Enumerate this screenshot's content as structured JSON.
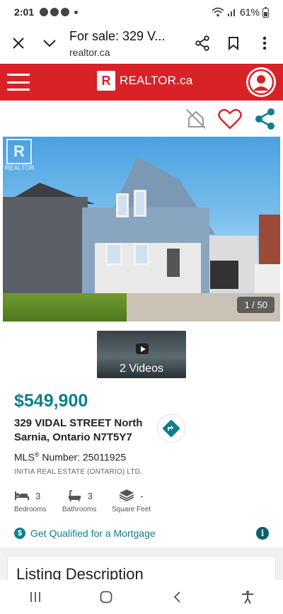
{
  "status_bar": {
    "time": "2:01",
    "battery": "61%"
  },
  "browser": {
    "title": "For sale: 329 V...",
    "domain": "realtor.ca"
  },
  "header": {
    "logo_letter": "R",
    "logo_text": "REALTOR.ca"
  },
  "gallery": {
    "counter": "1 / 50",
    "watermark": "REALTOR"
  },
  "videos": {
    "label": "2 Videos"
  },
  "listing": {
    "price": "$549,900",
    "address_line1": "329 VIDAL STREET North",
    "address_line2": "Sarnia, Ontario N7T5Y7",
    "mls_prefix": "MLS",
    "mls_reg": "®",
    "mls_rest": " Number: 25011925",
    "brokerage": "INITIA REAL ESTATE (ONTARIO) LTD."
  },
  "features": [
    {
      "icon": "bed-icon",
      "value": "3",
      "label": "Bedrooms"
    },
    {
      "icon": "bathtub-icon",
      "value": "3",
      "label": "Bathrooms"
    },
    {
      "icon": "cube-icon",
      "value": "-",
      "label": "Square Feet"
    }
  ],
  "mortgage": {
    "icon_glyph": "$",
    "label": "Get Qualified for a Mortgage",
    "info_glyph": "i"
  },
  "description": {
    "title": "Listing Description"
  },
  "colors": {
    "brand_red": "#d92228",
    "teal": "#0f7f8c",
    "heart_red": "#d92228"
  }
}
